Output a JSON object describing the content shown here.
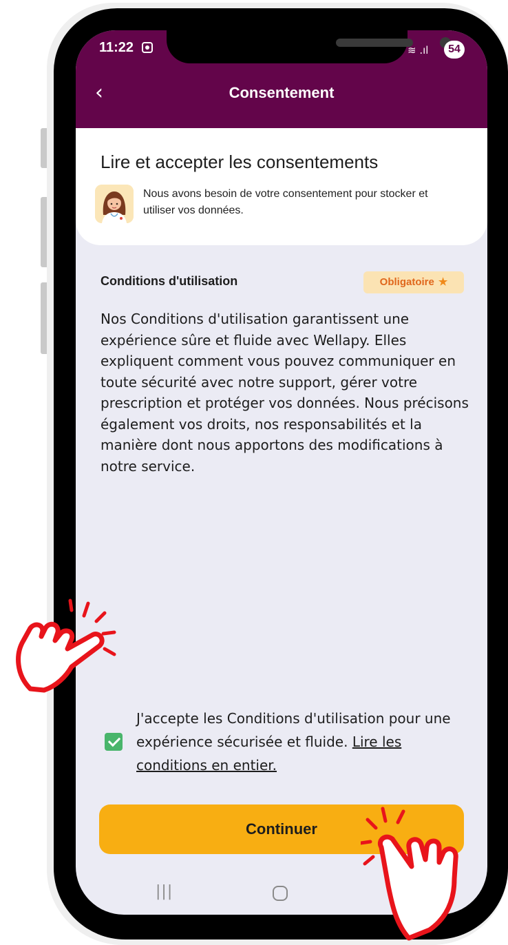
{
  "status_bar": {
    "time": "11:22",
    "battery": "54",
    "signal": "≋ .ıl"
  },
  "header": {
    "back_label": "‹",
    "title": "Consentement"
  },
  "intro_card": {
    "title": "Lire et accepter les consentements",
    "subtitle": "Nous avons besoin de votre consentement pour stocker et utiliser vos données."
  },
  "terms": {
    "section_title": "Conditions d'utilisation",
    "badge_label": "Obligatoire",
    "body": "Nos Conditions d'utilisation garantissent une expérience sûre et fluide avec Wellapy. Elles expliquent comment vous pouvez communiquer en toute sécurité avec notre support, gérer votre prescription et protéger vos données. Nous précisons également vos droits, nos responsabilités et la manière dont nous apportons des modifications à notre service."
  },
  "consent": {
    "checked": true,
    "text": "J'accepte les Conditions d'utilisation pour une expérience sécurisée et fluide. ",
    "link_text": "Lire les conditions en entier."
  },
  "continue_button": {
    "label": "Continuer"
  },
  "system_nav": {
    "recents": "|||",
    "back": "<"
  },
  "colors": {
    "header_bg": "#63054a",
    "screen_bg": "#ebebf4",
    "button_bg": "#f8ae12",
    "badge_bg": "#fbe3b3",
    "badge_text": "#e0671c",
    "checkbox": "#49b56b",
    "hand_outline": "#e8141b"
  },
  "icons": {
    "back": "chevron-left-icon",
    "badge": "star-icon",
    "checkbox": "check-icon",
    "avatar": "doctor-avatar-icon",
    "hands": "pointing-hand-icon"
  }
}
